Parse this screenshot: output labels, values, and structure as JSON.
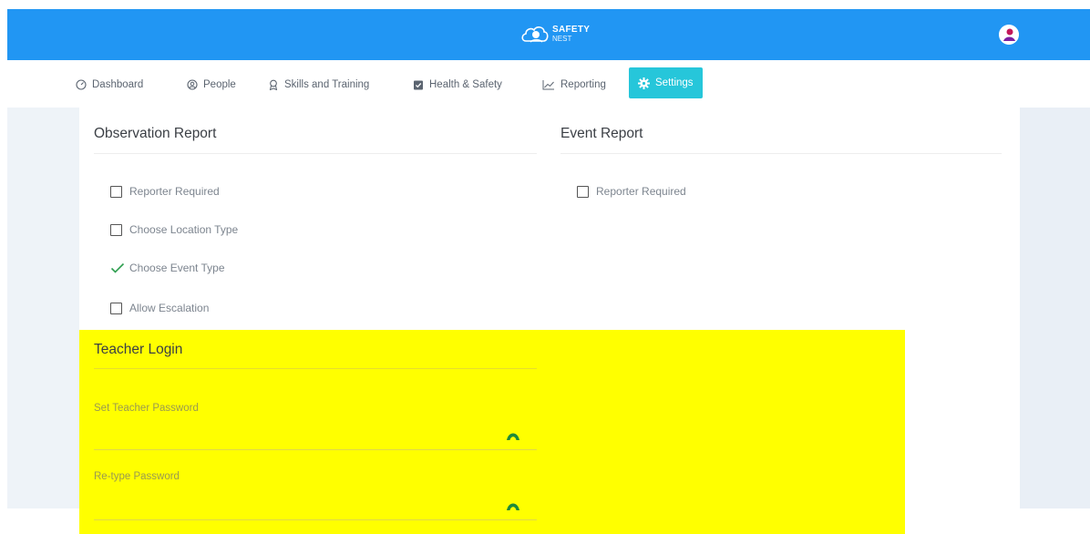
{
  "colors": {
    "topbar": "#2196f3",
    "active_tab": "#26c6da",
    "highlight": "#ffff00",
    "check_green": "#2e9e4f"
  },
  "header": {
    "brand_line1": "SAFETY",
    "brand_line2": "NEST",
    "logo_icon": "cloud-nest-logo",
    "avatar_icon": "user-avatar"
  },
  "nav": {
    "items": [
      {
        "label": "Dashboard",
        "icon": "dashboard-icon"
      },
      {
        "label": "People",
        "icon": "person-icon"
      },
      {
        "label": "Skills and Training",
        "icon": "award-icon"
      },
      {
        "label": "Health & Safety",
        "icon": "clipboard-check-icon"
      },
      {
        "label": "Reporting",
        "icon": "chart-line-icon"
      },
      {
        "label": "Settings",
        "icon": "gear-icon",
        "active": true
      }
    ]
  },
  "observation": {
    "title": "Observation Report",
    "options": [
      {
        "label": "Reporter Required",
        "checked": false
      },
      {
        "label": "Choose Location Type",
        "checked": false
      },
      {
        "label": "Choose Event Type",
        "checked": true
      },
      {
        "label": "Allow Escalation",
        "checked": false
      }
    ]
  },
  "event": {
    "title": "Event Report",
    "options": [
      {
        "label": "Reporter Required",
        "checked": false
      }
    ]
  },
  "teacher": {
    "title": "Teacher Login",
    "password_label": "Set Teacher Password",
    "password_value": "",
    "retype_label": "Re-type Password",
    "retype_value": ""
  }
}
